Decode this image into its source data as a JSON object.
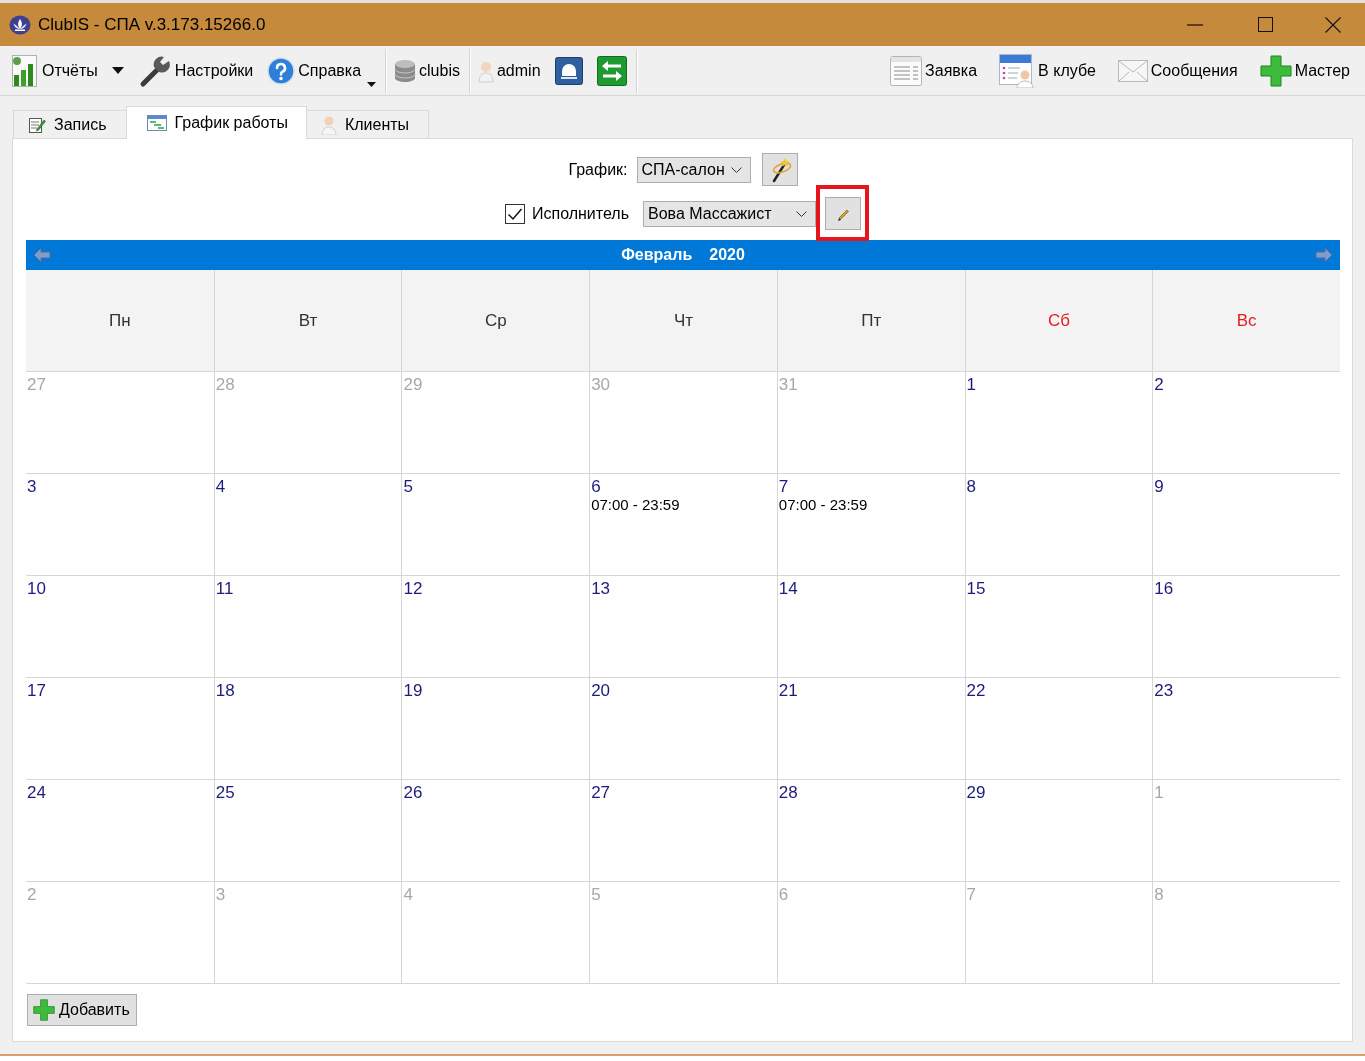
{
  "window": {
    "title": "ClubIS - СПА v.3.173.15266.0"
  },
  "toolbar": {
    "left_groups": [
      [
        {
          "kind": "labeled",
          "label": "Отчёты",
          "menu": false
        },
        {
          "kind": "arrow"
        },
        {
          "kind": "labeled",
          "label": "Настройки",
          "menu": false
        },
        {
          "kind": "labeled",
          "label": "Справка",
          "menu": true
        }
      ],
      [
        {
          "kind": "labeled",
          "label": "clubis",
          "menu": false
        }
      ],
      [
        {
          "kind": "labeled",
          "label": "admin",
          "menu": false
        },
        {
          "kind": "icon"
        },
        {
          "kind": "icon"
        }
      ]
    ],
    "right": [
      {
        "kind": "labeled",
        "label": "Заявка",
        "menu": false
      },
      {
        "kind": "labeled",
        "label": "В клубе",
        "menu": false
      },
      {
        "kind": "labeled",
        "label": "Сообщения",
        "menu": false
      },
      {
        "kind": "labeled",
        "label": "Мастер",
        "menu": false
      }
    ]
  },
  "tabs": [
    {
      "label": "Запись",
      "selected": false
    },
    {
      "label": "График работы",
      "selected": true
    },
    {
      "label": "Клиенты",
      "selected": false
    }
  ],
  "filters": {
    "schedule": {
      "label": "График:",
      "value": "СПА-салон"
    },
    "performer": {
      "checked": true,
      "label": "Исполнитель",
      "value": "Вова Массажист",
      "edit_highlighted": true
    }
  },
  "calendar": {
    "month": "Февраль",
    "year": "2020",
    "weekdays": [
      {
        "label": "Пн",
        "weekend": false
      },
      {
        "label": "Вт",
        "weekend": false
      },
      {
        "label": "Ср",
        "weekend": false
      },
      {
        "label": "Чт",
        "weekend": false
      },
      {
        "label": "Пт",
        "weekend": false
      },
      {
        "label": "Сб",
        "weekend": true
      },
      {
        "label": "Вс",
        "weekend": true
      }
    ],
    "weeks": [
      [
        {
          "day": "27",
          "other_month": true
        },
        {
          "day": "28",
          "other_month": true
        },
        {
          "day": "29",
          "other_month": true
        },
        {
          "day": "30",
          "other_month": true
        },
        {
          "day": "31",
          "other_month": true
        },
        {
          "day": "1",
          "other_month": false
        },
        {
          "day": "2",
          "other_month": false
        }
      ],
      [
        {
          "day": "3",
          "other_month": false
        },
        {
          "day": "4",
          "other_month": false
        },
        {
          "day": "5",
          "other_month": false
        },
        {
          "day": "6",
          "other_month": false,
          "shift": "07:00 - 23:59"
        },
        {
          "day": "7",
          "other_month": false,
          "shift": "07:00 - 23:59"
        },
        {
          "day": "8",
          "other_month": false
        },
        {
          "day": "9",
          "other_month": false
        }
      ],
      [
        {
          "day": "10",
          "other_month": false
        },
        {
          "day": "11",
          "other_month": false
        },
        {
          "day": "12",
          "other_month": false
        },
        {
          "day": "13",
          "other_month": false
        },
        {
          "day": "14",
          "other_month": false
        },
        {
          "day": "15",
          "other_month": false
        },
        {
          "day": "16",
          "other_month": false
        }
      ],
      [
        {
          "day": "17",
          "other_month": false
        },
        {
          "day": "18",
          "other_month": false
        },
        {
          "day": "19",
          "other_month": false
        },
        {
          "day": "20",
          "other_month": false
        },
        {
          "day": "21",
          "other_month": false
        },
        {
          "day": "22",
          "other_month": false
        },
        {
          "day": "23",
          "other_month": false
        }
      ],
      [
        {
          "day": "24",
          "other_month": false
        },
        {
          "day": "25",
          "other_month": false
        },
        {
          "day": "26",
          "other_month": false
        },
        {
          "day": "27",
          "other_month": false
        },
        {
          "day": "28",
          "other_month": false
        },
        {
          "day": "29",
          "other_month": false
        },
        {
          "day": "1",
          "other_month": true
        }
      ],
      [
        {
          "day": "2",
          "other_month": true
        },
        {
          "day": "3",
          "other_month": true
        },
        {
          "day": "4",
          "other_month": true
        },
        {
          "day": "5",
          "other_month": true
        },
        {
          "day": "6",
          "other_month": true
        },
        {
          "day": "7",
          "other_month": true
        },
        {
          "day": "8",
          "other_month": true
        }
      ]
    ]
  },
  "add_button": {
    "label": "Добавить"
  }
}
